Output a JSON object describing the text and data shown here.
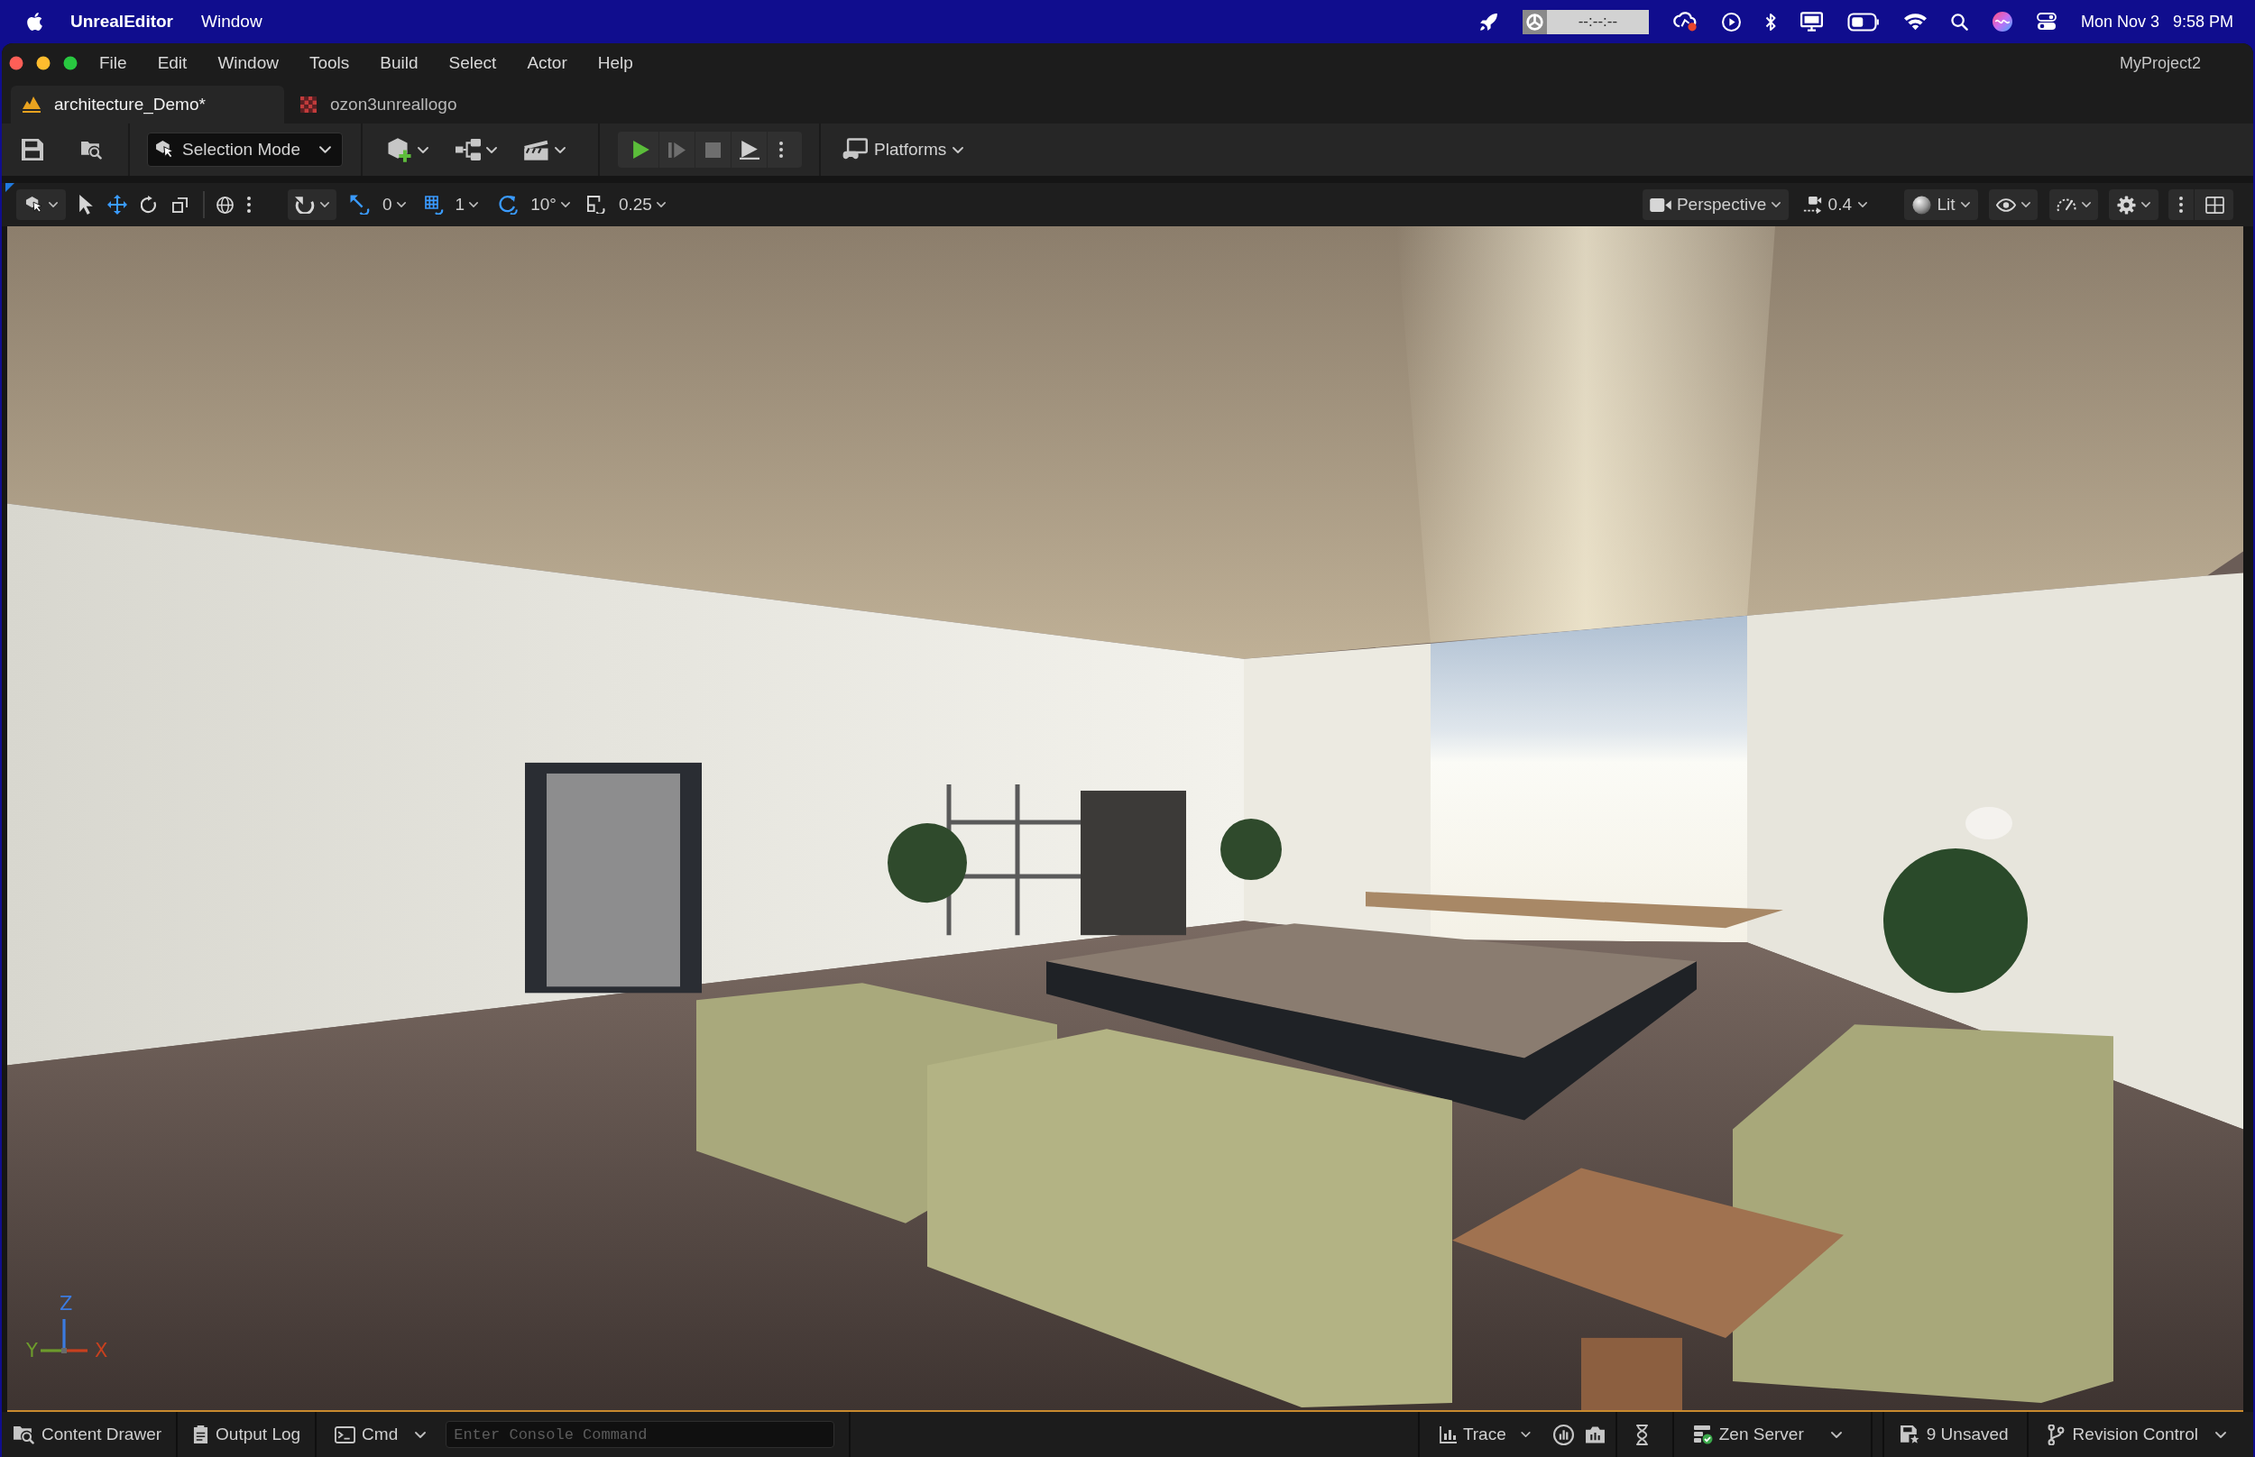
{
  "menu_bar": {
    "app_name": "UnrealEditor",
    "menus": [
      "Window"
    ],
    "timer": "--:--:--",
    "date": "Mon Nov 3",
    "time": "9:58 PM"
  },
  "window": {
    "menus": [
      "File",
      "Edit",
      "Window",
      "Tools",
      "Build",
      "Select",
      "Actor",
      "Help"
    ],
    "project": "MyProject2"
  },
  "tabs": [
    {
      "label": "architecture_Demo*",
      "kind": "level",
      "selected": true
    },
    {
      "label": "ozon3unreallogo",
      "kind": "texture",
      "selected": false
    }
  ],
  "toolbar": {
    "mode": "Selection Mode",
    "play_controls": [
      {
        "kind": "play",
        "disabled": false
      },
      {
        "kind": "advance",
        "disabled": true
      },
      {
        "kind": "stop",
        "disabled": true
      },
      {
        "kind": "launch",
        "disabled": false
      }
    ],
    "platforms": "Platforms"
  },
  "viewport_toolbar": {
    "transform_tools": [
      {
        "kind": "select",
        "selected": false
      },
      {
        "kind": "translate",
        "selected": true
      },
      {
        "kind": "rotate",
        "selected": false
      },
      {
        "kind": "scale",
        "selected": false
      }
    ],
    "snaps": [
      {
        "kind": "translate",
        "on": true,
        "value": "0"
      },
      {
        "kind": "grid",
        "on": true,
        "value": "1"
      },
      {
        "kind": "rotate",
        "on": true,
        "value": "10°"
      },
      {
        "kind": "scale",
        "on": false,
        "value": "0.25"
      }
    ],
    "view": "Perspective",
    "camera_speed": "0.4",
    "view_mode": "Lit"
  },
  "viewport": {
    "axes": [
      {
        "kind": "z",
        "label": "Z"
      },
      {
        "kind": "y",
        "label": "Y"
      },
      {
        "kind": "x",
        "label": "X"
      }
    ]
  },
  "status_bar": {
    "left": [
      {
        "kind": "content",
        "label": "Content Drawer"
      },
      {
        "kind": "log",
        "label": "Output Log"
      }
    ],
    "console": {
      "label": "Cmd",
      "placeholder": "Enter Console Command"
    },
    "right": [
      {
        "kind": "trace",
        "label": "Trace"
      },
      {
        "kind": "zen",
        "label": "Zen Server"
      },
      {
        "kind": "unsaved",
        "label": "9 Unsaved"
      },
      {
        "kind": "revision",
        "label": "Revision Control"
      }
    ]
  }
}
